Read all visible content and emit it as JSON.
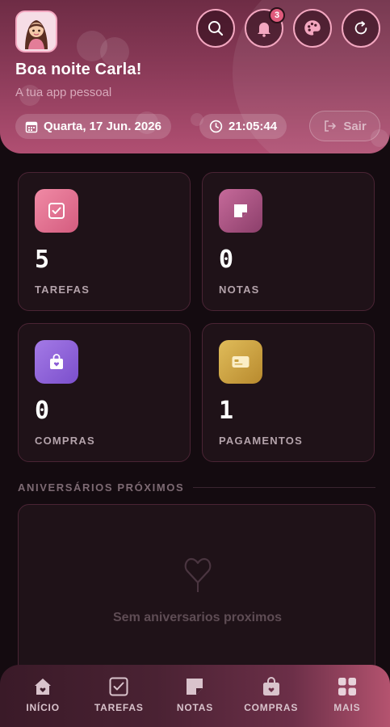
{
  "header": {
    "greeting": "Boa noite Carla!",
    "subtitle": "A tua app pessoal",
    "notifications_count": "3",
    "date": "Quarta, 17 Jun. 2026",
    "time": "21:05:44",
    "logout_label": "Sair",
    "icons": {
      "search": "search-icon",
      "notifications": "bell-icon",
      "theme": "palette-icon",
      "refresh": "refresh-icon",
      "calendar": "calendar-icon",
      "clock": "clock-icon",
      "logout": "logout-icon"
    }
  },
  "stats": [
    {
      "value": "5",
      "label": "TAREFAS",
      "icon": "checkbox-icon",
      "color": "#e0708e"
    },
    {
      "value": "0",
      "label": "NOTAS",
      "icon": "sticky-note-icon",
      "color": "#b0588a"
    },
    {
      "value": "0",
      "label": "COMPRAS",
      "icon": "shopping-bag-icon",
      "color": "#8e64d8"
    },
    {
      "value": "1",
      "label": "PAGAMENTOS",
      "icon": "credit-card-icon",
      "color": "#c9a040"
    }
  ],
  "birthdays": {
    "title": "ANIVERSÁRIOS PRÓXIMOS",
    "empty_text": "Sem aniversarios proximos",
    "icon": "balloon-icon"
  },
  "nav": [
    {
      "label": "INÍCIO",
      "icon": "home-icon"
    },
    {
      "label": "TAREFAS",
      "icon": "checkbox-icon"
    },
    {
      "label": "NOTAS",
      "icon": "sticky-note-icon"
    },
    {
      "label": "COMPRAS",
      "icon": "shopping-bag-icon"
    },
    {
      "label": "MAIS",
      "icon": "grid-icon"
    }
  ]
}
